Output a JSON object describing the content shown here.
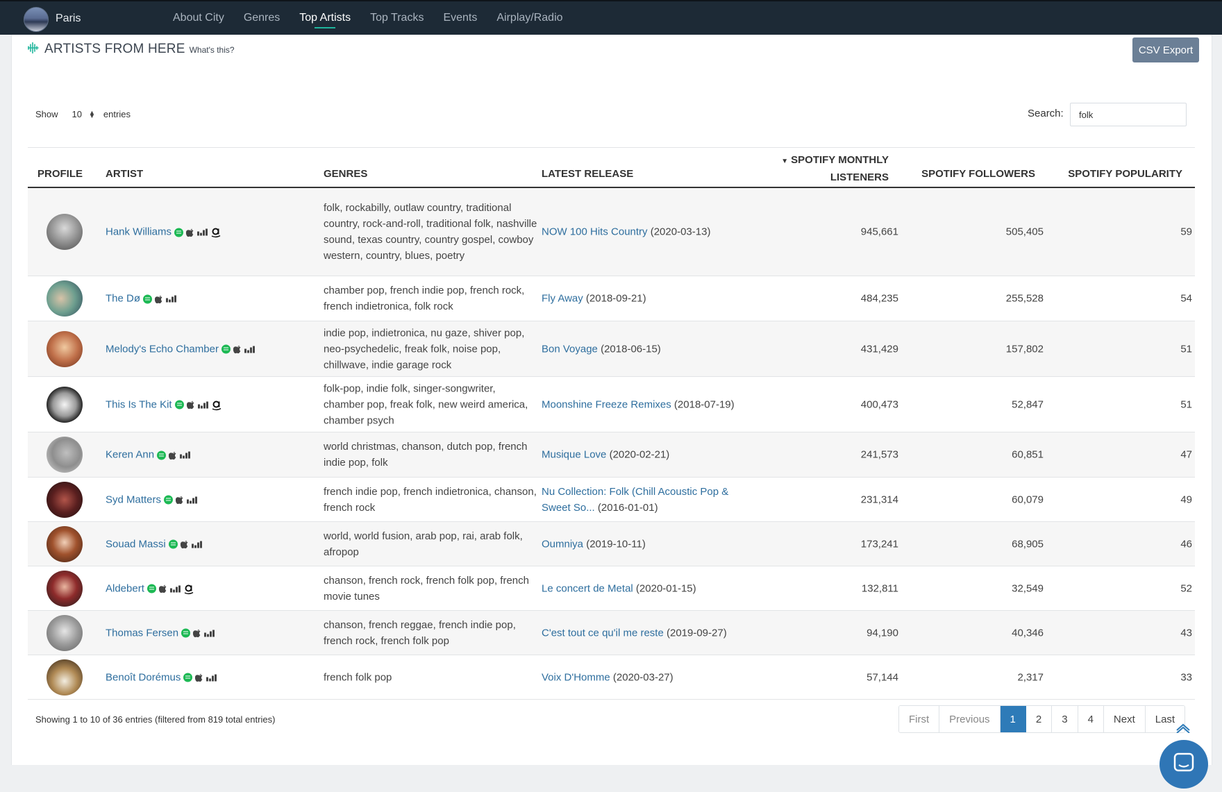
{
  "nav": {
    "city": "Paris",
    "items": [
      {
        "label": "About City"
      },
      {
        "label": "Genres"
      },
      {
        "label": "Top Artists"
      },
      {
        "label": "Top Tracks"
      },
      {
        "label": "Events"
      },
      {
        "label": "Airplay/Radio"
      }
    ],
    "active_index": 2
  },
  "page": {
    "title": "ARTISTS FROM HERE",
    "help_link": "What's this?",
    "csv_export": "CSV Export"
  },
  "controls": {
    "show_label": "Show",
    "entries_value": "10",
    "entries_label": "entries",
    "search_label": "Search:",
    "search_value": "folk"
  },
  "table": {
    "headers": {
      "profile": "PROFILE",
      "artist": "ARTIST",
      "genres": "GENRES",
      "latest_release": "LATEST RELEASE",
      "listeners_line1": "SPOTIFY MONTHLY",
      "listeners_line2": "LISTENERS",
      "followers": "SPOTIFY FOLLOWERS",
      "popularity": "SPOTIFY POPULARITY"
    },
    "rows": [
      {
        "artist": "Hank Williams",
        "amazon": true,
        "genres": "folk, rockabilly, outlaw country, traditional country, rock-and-roll, traditional folk, nashville sound, texas country, country gospel, cowboy western, country, blues, poetry",
        "release_title": "NOW 100 Hits Country",
        "release_date": "(2020-03-13)",
        "listeners": "945,661",
        "followers": "505,405",
        "popularity": "59"
      },
      {
        "artist": "The Dø",
        "amazon": false,
        "genres": "chamber pop, french indie pop, french rock, french indietronica, folk rock",
        "release_title": "Fly Away",
        "release_date": "(2018-09-21)",
        "listeners": "484,235",
        "followers": "255,528",
        "popularity": "54"
      },
      {
        "artist": "Melody's Echo Chamber",
        "amazon": false,
        "genres": "indie pop, indietronica, nu gaze, shiver pop, neo-psychedelic, freak folk, noise pop, chillwave, indie garage rock",
        "release_title": "Bon Voyage",
        "release_date": "(2018-06-15)",
        "listeners": "431,429",
        "followers": "157,802",
        "popularity": "51"
      },
      {
        "artist": "This Is The Kit",
        "amazon": true,
        "genres": "folk-pop, indie folk, singer-songwriter, chamber pop, freak folk, new weird america, chamber psych",
        "release_title": "Moonshine Freeze Remixes",
        "release_date": "(2018-07-19)",
        "listeners": "400,473",
        "followers": "52,847",
        "popularity": "51"
      },
      {
        "artist": "Keren Ann",
        "amazon": false,
        "genres": "world christmas, chanson, dutch pop, french indie pop, folk",
        "release_title": "Musique Love",
        "release_date": "(2020-02-21)",
        "listeners": "241,573",
        "followers": "60,851",
        "popularity": "47"
      },
      {
        "artist": "Syd Matters",
        "amazon": false,
        "genres": "french indie pop, french indietronica, chanson, french rock",
        "release_title": "Nu Collection: Folk (Chill Acoustic Pop & Sweet So...",
        "release_date": "(2016-01-01)",
        "listeners": "231,314",
        "followers": "60,079",
        "popularity": "49"
      },
      {
        "artist": "Souad Massi",
        "amazon": false,
        "genres": "world, world fusion, arab pop, rai, arab folk, afropop",
        "release_title": "Oumniya",
        "release_date": "(2019-10-11)",
        "listeners": "173,241",
        "followers": "68,905",
        "popularity": "46"
      },
      {
        "artist": "Aldebert",
        "amazon": true,
        "genres": "chanson, french rock, french folk pop, french movie tunes",
        "release_title": "Le concert de Metal",
        "release_date": "(2020-01-15)",
        "listeners": "132,811",
        "followers": "32,549",
        "popularity": "52"
      },
      {
        "artist": "Thomas Fersen",
        "amazon": false,
        "genres": "chanson, french reggae, french indie pop, french rock, french folk pop",
        "release_title": "C'est tout ce qu'il me reste",
        "release_date": "(2019-09-27)",
        "listeners": "94,190",
        "followers": "40,346",
        "popularity": "43"
      },
      {
        "artist": "Benoît Dorémus",
        "amazon": false,
        "genres": "french folk pop",
        "release_title": "Voix D'Homme",
        "release_date": "(2020-03-27)",
        "listeners": "57,144",
        "followers": "2,317",
        "popularity": "33"
      }
    ]
  },
  "footer": {
    "info": "Showing 1 to 10 of 36 entries (filtered from 819 total entries)",
    "pagination": [
      "First",
      "Previous",
      "1",
      "2",
      "3",
      "4",
      "Next",
      "Last"
    ],
    "active_page": "1"
  },
  "colors": {
    "navbar": "#1d2a36",
    "accent": "#1fb59c",
    "link": "#2e6e9e",
    "spotify": "#1db954",
    "page_active": "#2e7bb8"
  }
}
